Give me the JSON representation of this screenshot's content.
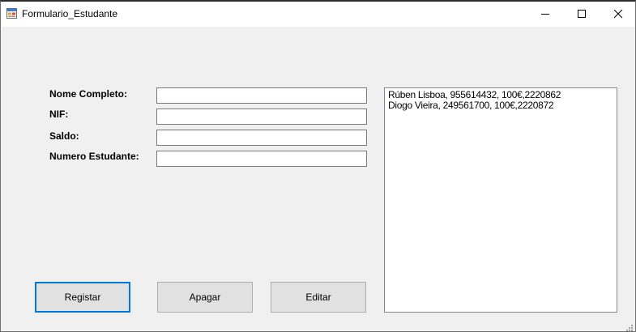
{
  "window": {
    "title": "Formulario_Estudante"
  },
  "form": {
    "labels": {
      "nome": "Nome Completo:",
      "nif": "NIF:",
      "saldo": "Saldo:",
      "numero": "Numero Estudante:"
    },
    "values": {
      "nome": "",
      "nif": "",
      "saldo": "",
      "numero": ""
    }
  },
  "list": {
    "items": [
      "Rúben Lisboa, 955614432, 100€,2220862",
      "Diogo Vieira, 249561700, 100€,2220872"
    ]
  },
  "buttons": {
    "registar": "Registar",
    "apagar": "Apagar",
    "editar": "Editar"
  },
  "icons": {
    "app": "app-form-icon",
    "minimize": "minimize-icon",
    "maximize": "maximize-icon",
    "close": "close-icon",
    "grip": "resize-grip-icon"
  },
  "colors": {
    "window_bg": "#f0f0f0",
    "titlebar_bg": "#ffffff",
    "focus_border": "#0078d7",
    "button_bg": "#e1e1e1"
  }
}
